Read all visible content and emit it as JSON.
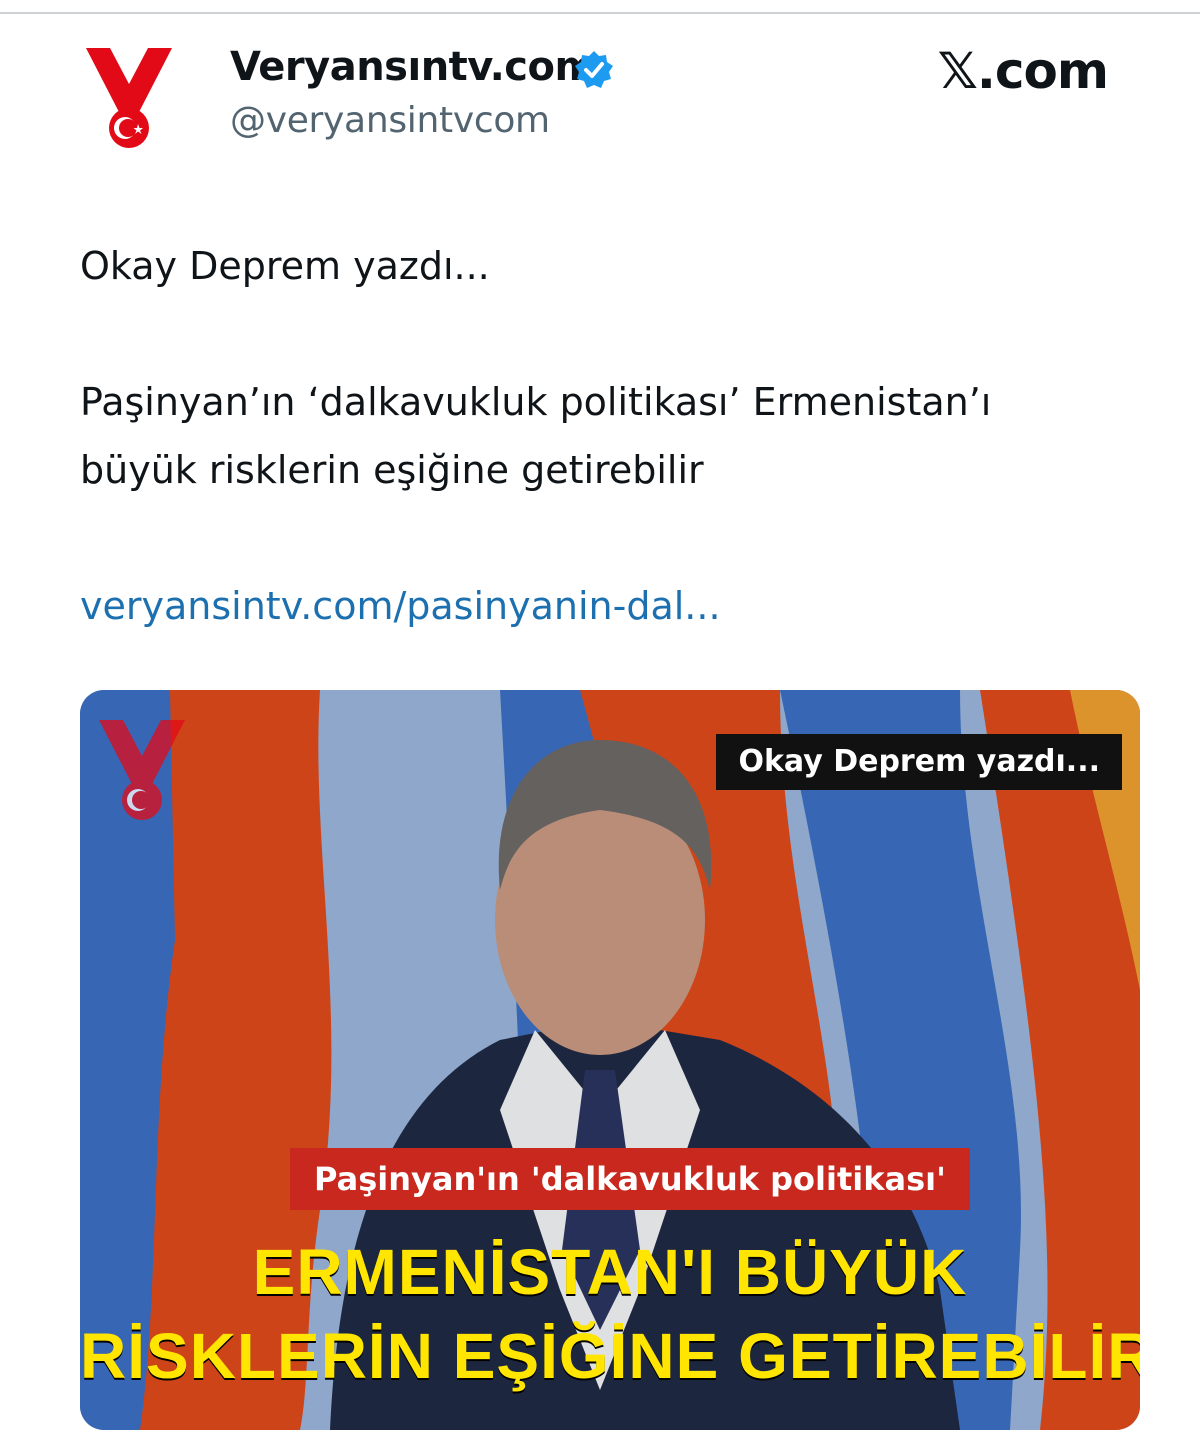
{
  "author": {
    "name": "Veryansıntv.com",
    "handle": "@veryansintvcom",
    "verified_color": "#1d9bf0",
    "logo_colors": {
      "red": "#e30a17",
      "white": "#ffffff"
    }
  },
  "brand": {
    "label": "𝕏.com"
  },
  "tweet": {
    "line1": "Okay Deprem yazdı...",
    "line2": "Paşinyan’ın ‘dalkavukluk politikası’ Ermenistan’ı\nbüyük risklerin eşiğine getirebilir",
    "link": "veryansintv.com/pasinyanin-dal...",
    "link_color": "#1d70b0"
  },
  "media": {
    "kicker": "Okay Deprem yazdı...",
    "band": "Paşinyan'ın 'dalkavukluk politikası'",
    "headline_line1": "ERMENİSTAN'I BÜYÜK",
    "headline_line2": "RİSKLERİN EŞİĞİNE GETİREBİLİR",
    "colors": {
      "flag_red": "#e04a1c",
      "flag_blue": "#3b6fc4",
      "flag_orange": "#f0a030",
      "headline": "#ffe500",
      "band": "#c8281e"
    }
  }
}
